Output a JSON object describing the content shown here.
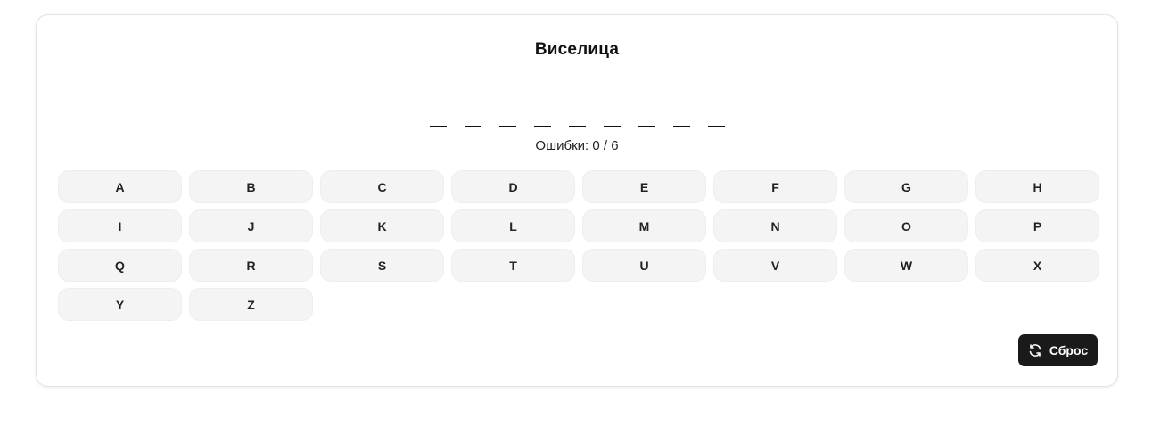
{
  "game": {
    "title": "Виселица",
    "word_slots": [
      "",
      "",
      "",
      "",
      "",
      "",
      "",
      "",
      ""
    ],
    "errors_text": "Ошибки: 0 / 6",
    "errors": 0,
    "max_errors": 6
  },
  "keyboard": {
    "letters": [
      "A",
      "B",
      "C",
      "D",
      "E",
      "F",
      "G",
      "H",
      "I",
      "J",
      "K",
      "L",
      "M",
      "N",
      "O",
      "P",
      "Q",
      "R",
      "S",
      "T",
      "U",
      "V",
      "W",
      "X",
      "Y",
      "Z"
    ]
  },
  "reset": {
    "label": "Сброс",
    "icon": "refresh-icon"
  },
  "colors": {
    "accent": "#1a1a1a",
    "key_background": "#f4f4f4",
    "card_border": "#e3e3e3"
  }
}
